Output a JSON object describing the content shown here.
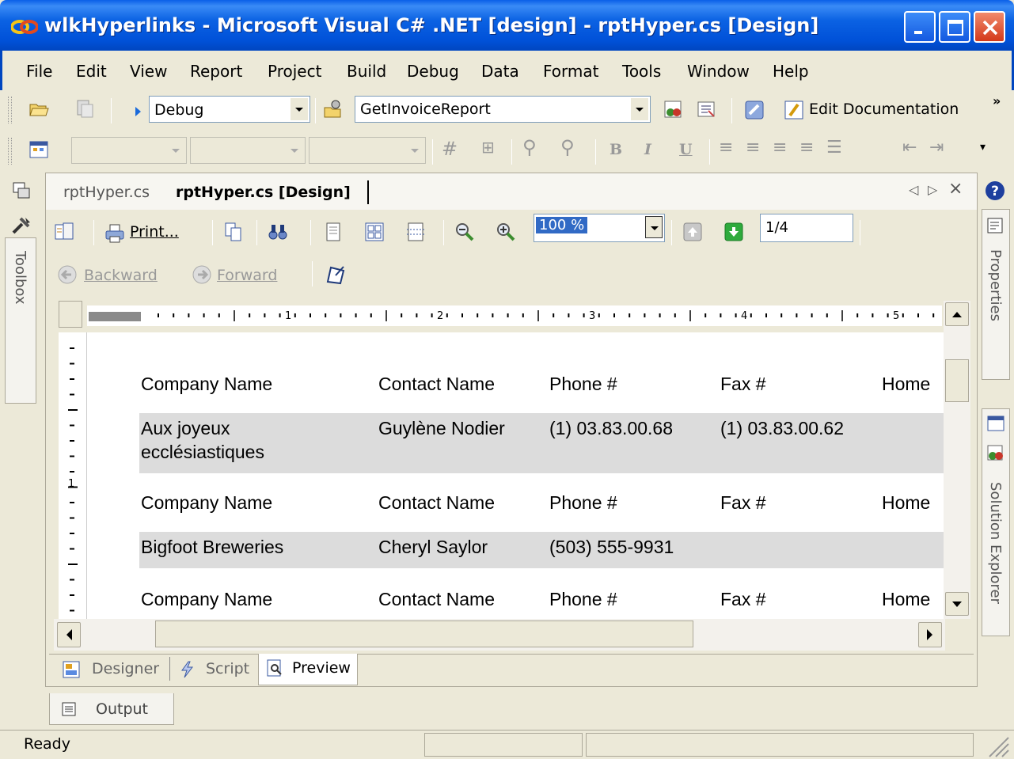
{
  "window": {
    "title": "wlkHyperlinks - Microsoft Visual C# .NET [design] - rptHyper.cs [Design]"
  },
  "menu": [
    "File",
    "Edit",
    "View",
    "Report",
    "Project",
    "Build",
    "Debug",
    "Data",
    "Format",
    "Tools",
    "Window",
    "Help"
  ],
  "toolbar1": {
    "config": "Debug",
    "find": "GetInvoiceReport",
    "edit_doc": "Edit Documentation"
  },
  "toolbar2": {
    "bold": "B",
    "italic": "I",
    "underline": "U"
  },
  "side": {
    "toolbox": "Toolbox",
    "properties": "Properties",
    "solution_explorer": "Solution Explorer"
  },
  "tabs": {
    "code": "rptHyper.cs",
    "design": "rptHyper.cs [Design]"
  },
  "viewer": {
    "print": "Print...",
    "zoom": "100 %",
    "page": "1/4",
    "backward": "Backward",
    "forward": "Forward"
  },
  "ruler": {
    "marks": [
      "1",
      "2",
      "3",
      "4",
      "5"
    ],
    "vmark": "1"
  },
  "report": {
    "headers": [
      "Company Name",
      "Contact Name",
      "Phone #",
      "Fax #",
      "Home"
    ],
    "records": [
      {
        "company_line1": "Aux joyeux",
        "company_line2": "ecclésiastiques",
        "contact": "Guylène Nodier",
        "phone": "(1) 03.83.00.68",
        "fax": "(1) 03.83.00.62"
      },
      {
        "company": "Bigfoot Breweries",
        "contact": "Cheryl Saylor",
        "phone": "(503) 555-9931",
        "fax": ""
      }
    ]
  },
  "designer_tabs": {
    "designer": "Designer",
    "script": "Script",
    "preview": "Preview"
  },
  "output": "Output",
  "status": "Ready"
}
